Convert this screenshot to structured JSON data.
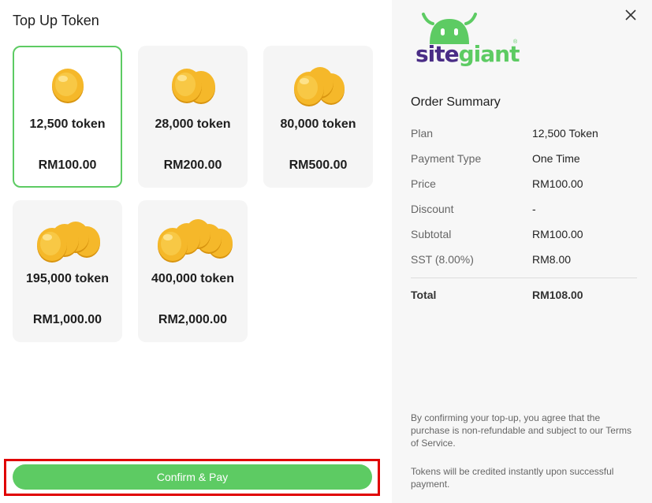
{
  "title": "Top Up Token",
  "packages": [
    {
      "tokens": "12,500 token",
      "price": "RM100.00",
      "selected": true
    },
    {
      "tokens": "28,000 token",
      "price": "RM200.00",
      "selected": false
    },
    {
      "tokens": "80,000 token",
      "price": "RM500.00",
      "selected": false
    },
    {
      "tokens": "195,000 token",
      "price": "RM1,000.00",
      "selected": false
    },
    {
      "tokens": "400,000 token",
      "price": "RM2,000.00",
      "selected": false
    }
  ],
  "confirm_label": "Confirm & Pay",
  "logo": {
    "part1": "site",
    "part2": "giant",
    "mark": "®"
  },
  "close_label": "X",
  "summary": {
    "title": "Order Summary",
    "rows": [
      {
        "label": "Plan",
        "value": "12,500 Token"
      },
      {
        "label": "Payment Type",
        "value": "One Time"
      },
      {
        "label": "Price",
        "value": "RM100.00"
      },
      {
        "label": "Discount",
        "value": "-"
      },
      {
        "label": "Subtotal",
        "value": "RM100.00"
      },
      {
        "label": "SST (8.00%)",
        "value": "RM8.00"
      }
    ],
    "total": {
      "label": "Total",
      "value": "RM108.00"
    }
  },
  "notes": {
    "terms": "By confirming your top-up, you agree that the purchase is non-refundable and subject to our Terms of Service.",
    "credit": "Tokens will be credited instantly upon successful payment."
  },
  "colors": {
    "accent": "#5dcb63",
    "brand_purple": "#4a2d86",
    "highlight": "#e00000",
    "coin": "#f5b82a"
  }
}
